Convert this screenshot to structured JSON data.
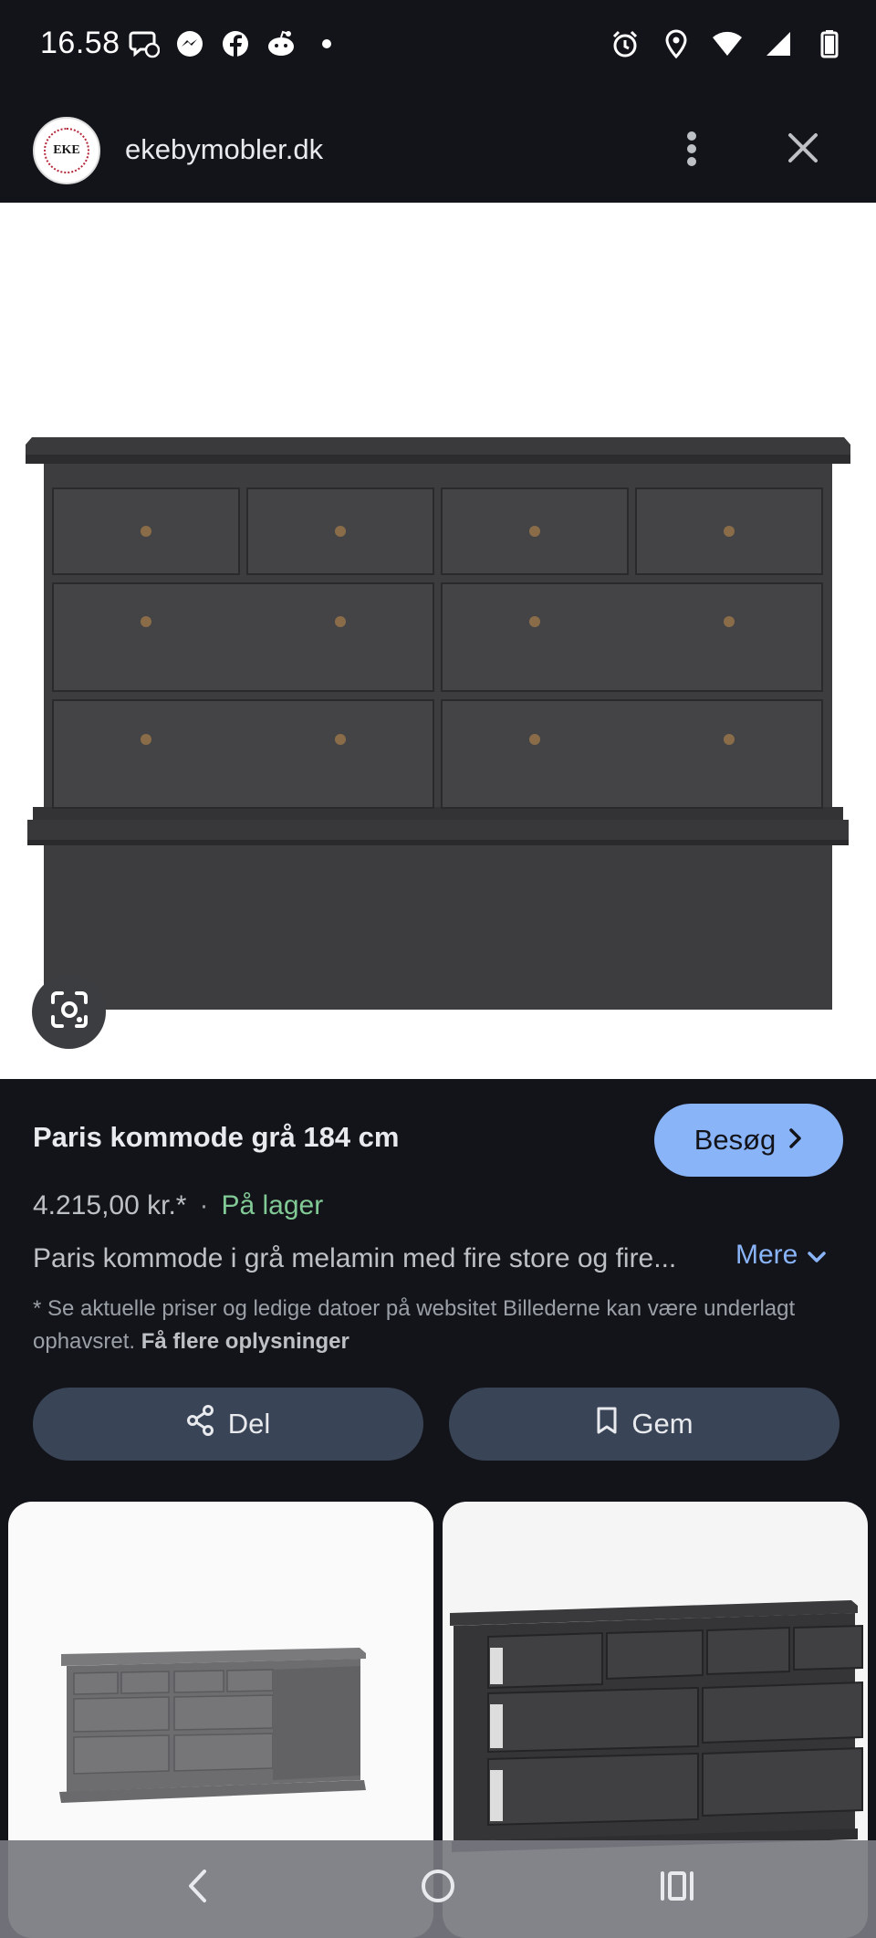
{
  "status_bar": {
    "time": "16.58"
  },
  "header": {
    "logo_text": "EKE",
    "site_name": "ekebymobler.dk"
  },
  "product": {
    "title": "Paris kommode grå 184 cm",
    "visit_label": "Besøg",
    "price": "4.215,00 kr.*",
    "separator": "·",
    "stock": "På lager",
    "description": "Paris kommode i grå melamin med fire store og fire...",
    "more_label": "Mere",
    "disclaimer": "* Se aktuelle priser og ledige datoer på websitet Billederne kan være underlagt ophavsret.",
    "disclaimer_link": "Få flere oplysninger"
  },
  "actions": {
    "share_label": "Del",
    "save_label": "Gem"
  },
  "colors": {
    "background": "#13141a",
    "accent": "#8ab4f8",
    "stock_green": "#81c995",
    "button_bg": "#394457",
    "dresser": "#3b3b3e"
  }
}
